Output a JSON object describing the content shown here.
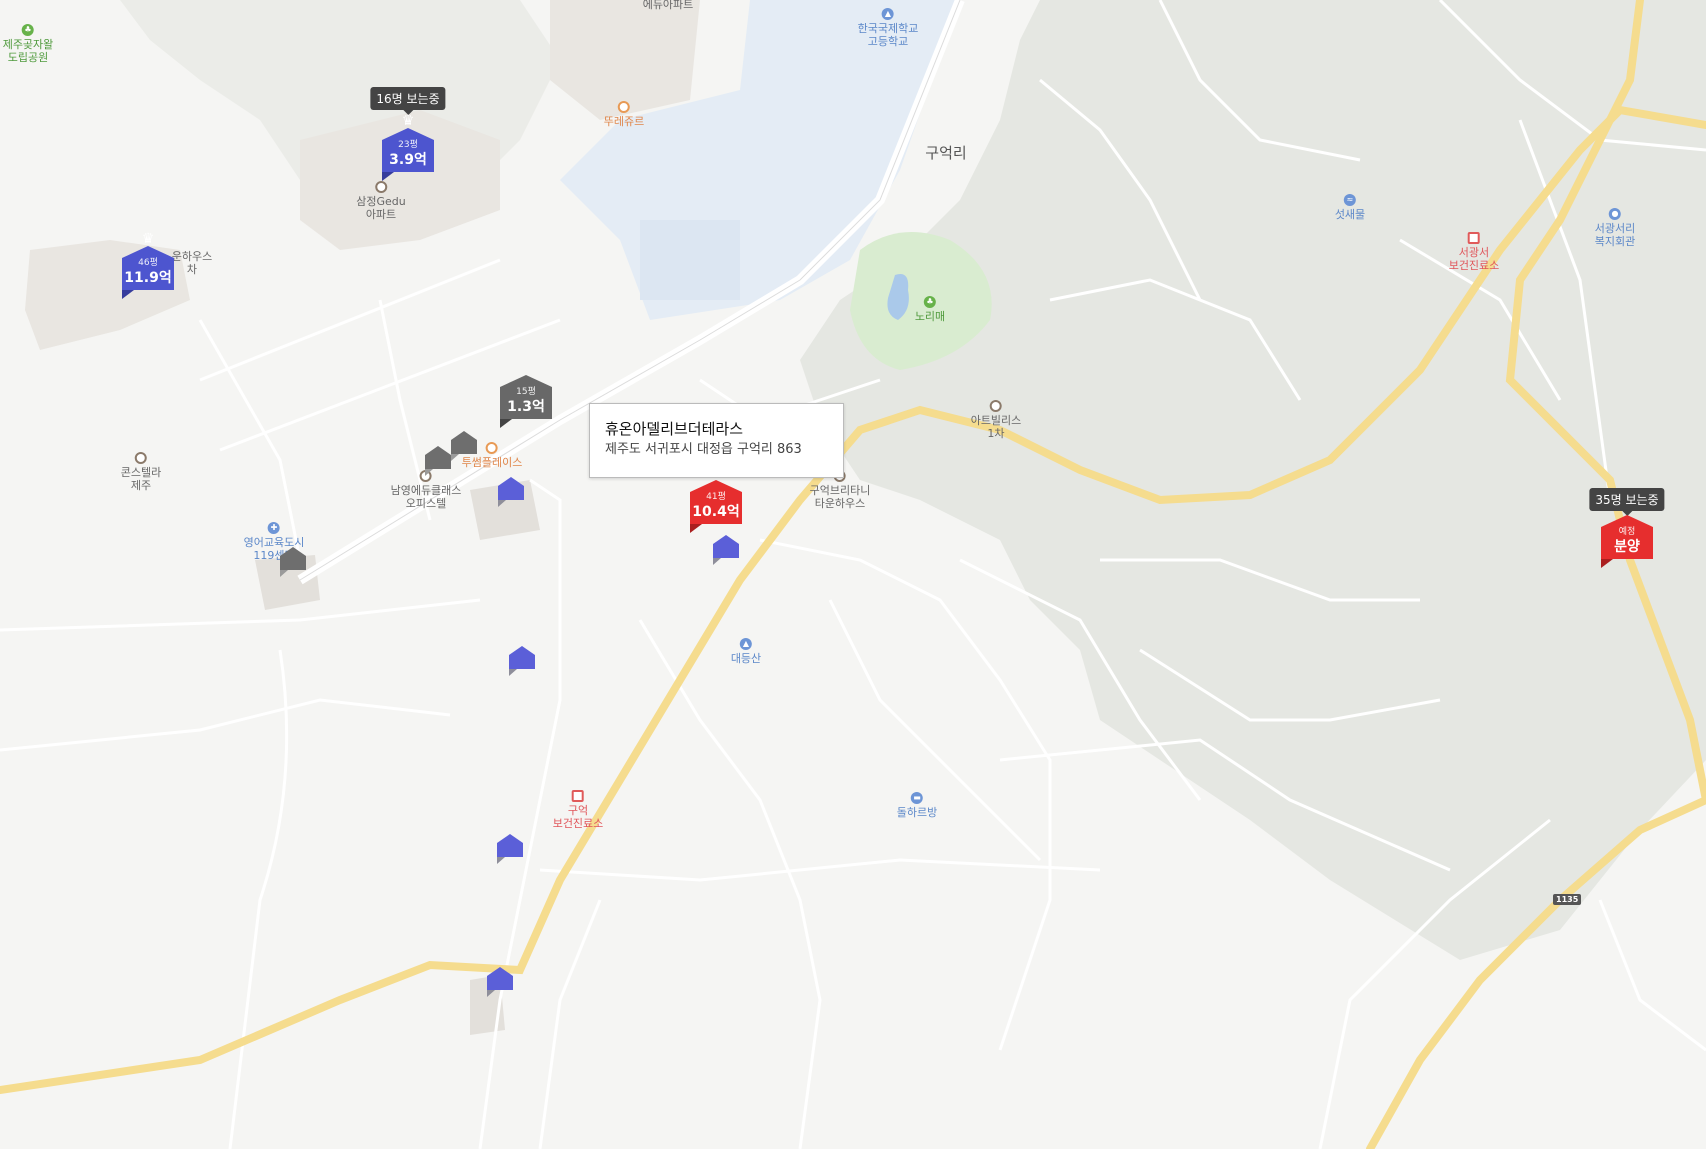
{
  "map": {
    "region_label": "구억리",
    "route_shield": "1135"
  },
  "places": [
    {
      "key": "park",
      "name": "제주곶자왈\n도립공원",
      "color": "green",
      "icon": "park-icon"
    },
    {
      "key": "edu-apt",
      "name": "에듀아파트",
      "color": "gray",
      "icon": "apartment-icon"
    },
    {
      "key": "kis",
      "name": "한국국제학교\n고등학교",
      "color": "blue",
      "icon": "school-icon"
    },
    {
      "key": "tourjour",
      "name": "뚜레쥬르",
      "color": "orange",
      "icon": "restaurant-icon"
    },
    {
      "key": "samjeong",
      "name": "삼정Gedu\n아파트",
      "color": "gray",
      "icon": "apartment-icon"
    },
    {
      "key": "townhouse",
      "name": "운하우스\n차",
      "color": "gray",
      "icon": "apartment-icon"
    },
    {
      "key": "sutsaemul",
      "name": "섯새물",
      "color": "blue",
      "icon": "water-icon"
    },
    {
      "key": "seogwang-clinic",
      "name": "서광서\n보건진료소",
      "color": "red",
      "icon": "hospital-icon"
    },
    {
      "key": "seogwang-welfare",
      "name": "서광서리\n복지회관",
      "color": "blue",
      "icon": "community-center-icon"
    },
    {
      "key": "norimae",
      "name": "노리매",
      "color": "green",
      "icon": "park-icon"
    },
    {
      "key": "artvillas",
      "name": "아트빌리스\n1차",
      "color": "gray",
      "icon": "apartment-icon"
    },
    {
      "key": "twosome",
      "name": "투썸플레이스",
      "color": "orange",
      "icon": "cafe-icon"
    },
    {
      "key": "namyoung",
      "name": "남영에듀클래스\n오피스텔",
      "color": "gray",
      "icon": "apartment-icon"
    },
    {
      "key": "constella",
      "name": "콘스텔라\n제주",
      "color": "gray",
      "icon": "apartment-icon"
    },
    {
      "key": "fire-station",
      "name": "영어교육도시\n119센터",
      "color": "blue",
      "icon": "fire-station-icon"
    },
    {
      "key": "britani",
      "name": "구억브리타니\n타운하우스",
      "color": "gray",
      "icon": "apartment-icon"
    },
    {
      "key": "daedeungsan",
      "name": "대등산",
      "color": "blue",
      "icon": "mountain-icon"
    },
    {
      "key": "guuk-clinic",
      "name": "구억\n보건진료소",
      "color": "red",
      "icon": "hospital-icon"
    },
    {
      "key": "dolharbang",
      "name": "돌하르방",
      "color": "blue",
      "icon": "lodging-icon"
    }
  ],
  "viewer_badges": [
    {
      "key": "samjeong",
      "text": "16명 보는중"
    },
    {
      "key": "presale",
      "text": "35명 보는중"
    }
  ],
  "markers": [
    {
      "key": "samjeong",
      "size": "23평",
      "price": "3.9억",
      "color": "blue",
      "crown": true
    },
    {
      "key": "townhouse",
      "size": "46평",
      "price": "11.9억",
      "color": "blue",
      "crown": true
    },
    {
      "key": "namyoung",
      "size": "15평",
      "price": "1.3억",
      "color": "gray",
      "crown": false
    },
    {
      "key": "selected",
      "size": "41평",
      "price": "10.4억",
      "color": "red",
      "crown": false
    },
    {
      "key": "presale",
      "size": "예정",
      "price": "분양",
      "color": "red",
      "crown": false
    }
  ],
  "popup": {
    "title": "휴온아델리브더테라스",
    "address": "제주도 서귀포시 대정읍 구억리 863"
  }
}
